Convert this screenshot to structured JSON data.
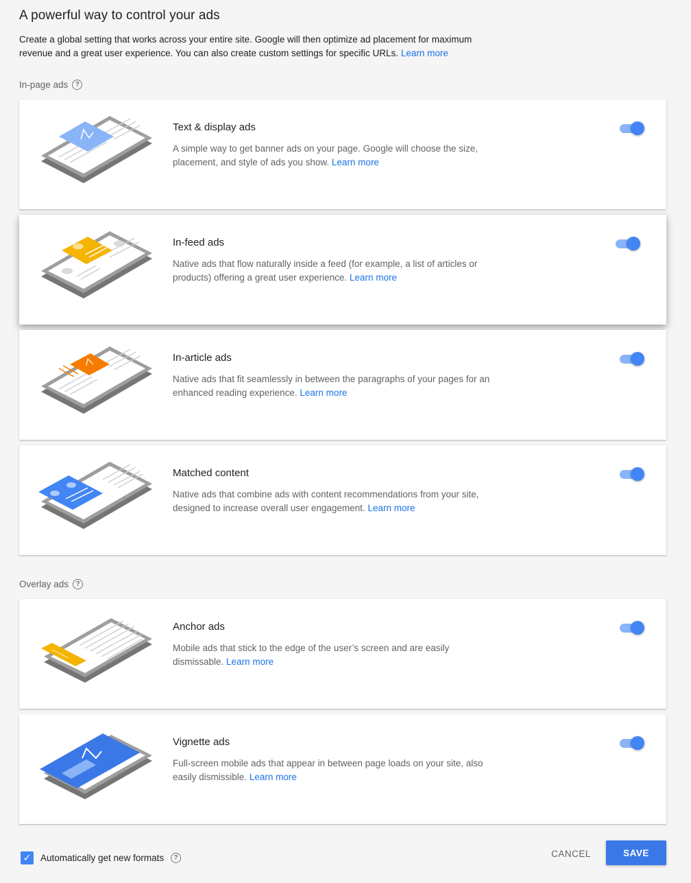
{
  "header": {
    "title": "A powerful way to control your ads",
    "intro": "Create a global setting that works across your entire site. Google will then optimize ad placement for maximum revenue and a great user experience. You can also create custom settings for specific URLs.",
    "intro_link": "Learn more"
  },
  "sections": {
    "in_page": {
      "label": "In-page ads",
      "help_icon": "help-circle-icon"
    },
    "overlay": {
      "label": "Overlay ads",
      "help_icon": "help-circle-icon"
    }
  },
  "cards": [
    {
      "title": "Text & display ads",
      "description": "A simple way to get banner ads on your page. Google will choose the size, placement, and style of ads you show.",
      "link": "Learn more",
      "enabled": true,
      "accent": "#8ab4f8"
    },
    {
      "title": "In-feed ads",
      "description": "Native ads that flow naturally inside a feed (for example, a list of articles or products) offering a great user experience.",
      "link": "Learn more",
      "enabled": true,
      "accent": "#f4b400"
    },
    {
      "title": "In-article ads",
      "description": "Native ads that fit seamlessly in between the paragraphs of your pages for an enhanced reading experience.",
      "link": "Learn more",
      "enabled": true,
      "accent": "#f57c00"
    },
    {
      "title": "Matched content",
      "description": "Native ads that combine ads with content recommendations from your site, designed to increase overall user engagement.",
      "link": "Learn more",
      "enabled": true,
      "accent": "#4285f4"
    },
    {
      "title": "Anchor ads",
      "description": "Mobile ads that stick to the edge of the user’s screen and are easily dismissable.",
      "link": "Learn more",
      "enabled": true,
      "accent": "#f4b400"
    },
    {
      "title": "Vignette ads",
      "description": "Full-screen mobile ads that appear in between page loads on your site, also easily dismissible.",
      "link": "Learn more",
      "enabled": true,
      "accent": "#3b78e7"
    }
  ],
  "footer": {
    "checkbox_label": "Automatically get new formats",
    "checkbox_checked": true,
    "checkbox_mark": "✓",
    "cancel_label": "CANCEL",
    "save_label": "SAVE"
  },
  "colors": {
    "link": "#1a73e8",
    "toggle_on": "#4285f4",
    "toggle_track": "#8ab4f8",
    "primary_button": "#3b78e7"
  }
}
